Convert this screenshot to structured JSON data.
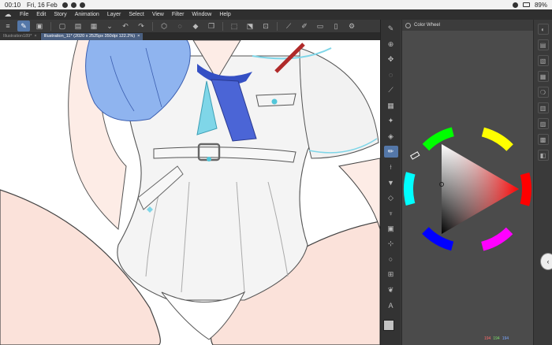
{
  "status_bar": {
    "time": "00:10",
    "date": "Fri, 16 Feb",
    "battery": "89%"
  },
  "menu": {
    "items": [
      "File",
      "Edit",
      "Story",
      "Animation",
      "Layer",
      "Select",
      "View",
      "Filter",
      "Window",
      "Help"
    ]
  },
  "tabs": [
    {
      "label": "Illustration189*",
      "close": "×"
    },
    {
      "label": "Illustration_11* (2020 x 2525px 350dpi 122.2%)",
      "close": "×"
    }
  ],
  "panel": {
    "title": "Color Wheel"
  },
  "color_values": {
    "r": "194",
    "g": "194",
    "b": "194"
  },
  "colors": {
    "accent": "#5477a8",
    "main_color": "#c2c2c2",
    "sub_color": "#f3d38a",
    "panel_bg": "#4b4b4b"
  }
}
